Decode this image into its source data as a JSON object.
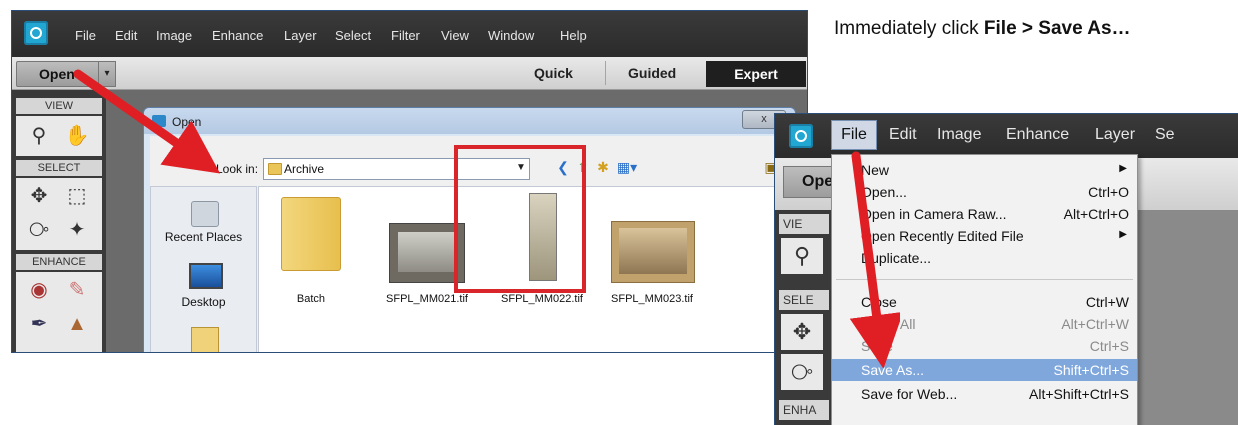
{
  "instruction": {
    "prefix": "Immediately click ",
    "bold": "File > Save As…"
  },
  "left_screenshot": {
    "menubar": [
      "File",
      "Edit",
      "Image",
      "Enhance",
      "Layer",
      "Select",
      "Filter",
      "View",
      "Window",
      "Help"
    ],
    "open_button": "Open",
    "modes": {
      "quick": "Quick",
      "guided": "Guided",
      "expert": "Expert"
    },
    "tool_sections": {
      "view": "VIEW",
      "select": "SELECT",
      "enhance": "ENHANCE"
    },
    "dialog": {
      "title": "Open",
      "close": "x",
      "look_in_label": "Look in:",
      "look_in_value": "Archive",
      "places": [
        "Recent Places",
        "Desktop"
      ],
      "files": [
        "Batch",
        "SFPL_MM021.tif",
        "SFPL_MM022.tif",
        "SFPL_MM023.tif"
      ],
      "selected_file": "SFPL_MM023.tif"
    }
  },
  "right_screenshot": {
    "menubar": [
      "File",
      "Edit",
      "Image",
      "Enhance",
      "Layer",
      "Se"
    ],
    "open_button": "Ope",
    "tool_sections": {
      "view": "VIE",
      "select": "SELE",
      "enhance": "ENHA"
    },
    "file_menu": [
      {
        "label": "New",
        "shortcut": "",
        "submenu": true,
        "disabled": false
      },
      {
        "label": "Open...",
        "shortcut": "Ctrl+O",
        "submenu": false,
        "disabled": false
      },
      {
        "label": "Open in Camera Raw...",
        "shortcut": "Alt+Ctrl+O",
        "submenu": false,
        "disabled": false
      },
      {
        "label": "Open Recently Edited File",
        "shortcut": "",
        "submenu": true,
        "disabled": false
      },
      {
        "label": "Duplicate...",
        "shortcut": "",
        "submenu": false,
        "disabled": false
      },
      {
        "label": "Close",
        "shortcut": "Ctrl+W",
        "submenu": false,
        "disabled": false
      },
      {
        "label": "Close All",
        "shortcut": "Alt+Ctrl+W",
        "submenu": false,
        "disabled": true
      },
      {
        "label": "Save",
        "shortcut": "Ctrl+S",
        "submenu": false,
        "disabled": true
      },
      {
        "label": "Save As...",
        "shortcut": "Shift+Ctrl+S",
        "submenu": false,
        "disabled": false,
        "highlighted": true
      },
      {
        "label": "Save for Web...",
        "shortcut": "Alt+Shift+Ctrl+S",
        "submenu": false,
        "disabled": false
      }
    ]
  },
  "colors": {
    "accent_red": "#d9262b",
    "highlight_blue": "#7fa7dc",
    "app_blue": "#22a6d2"
  }
}
